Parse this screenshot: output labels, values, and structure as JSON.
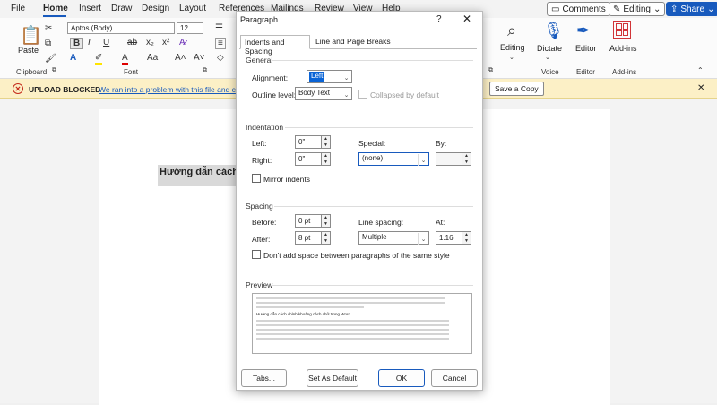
{
  "menu": {
    "items": [
      "File",
      "Home",
      "Insert",
      "Draw",
      "Design",
      "Layout",
      "References",
      "Mailings",
      "Review",
      "View",
      "Help"
    ]
  },
  "topbar": {
    "comments_label": "Comments",
    "editing_label": "Editing",
    "share_label": "Share"
  },
  "ribbon": {
    "paste_label": "Paste",
    "font_name": "Aptos (Body)",
    "font_size": "12",
    "groups": {
      "clipboard": "Clipboard",
      "font": "Font",
      "voice": "Voice",
      "editor": "Editor",
      "addins": "Add-ins"
    },
    "editing_label": "Editing",
    "dictate_label": "Dictate",
    "editor_label": "Editor",
    "addins_label": "Add-ins"
  },
  "upload_bar": {
    "title": "UPLOAD BLOCKED",
    "message": "We ran into a problem with this file and c",
    "save_copy_label": "Save a Copy"
  },
  "document": {
    "heading": "Hướng dẫn cách c"
  },
  "dialog": {
    "title": "Paragraph",
    "help": "?",
    "close": "✕",
    "tabs": [
      "Indents and Spacing",
      "Line and Page Breaks"
    ],
    "general": {
      "section": "General",
      "alignment_label": "Alignment:",
      "alignment_value": "Left",
      "outline_label": "Outline level:",
      "outline_value": "Body Text",
      "collapsed_label": "Collapsed by default"
    },
    "indentation": {
      "section": "Indentation",
      "left_label": "Left:",
      "left_value": "0\"",
      "right_label": "Right:",
      "right_value": "0\"",
      "special_label": "Special:",
      "special_value": "(none)",
      "by_label": "By:",
      "mirror_label": "Mirror indents"
    },
    "spacing": {
      "section": "Spacing",
      "before_label": "Before:",
      "before_value": "0 pt",
      "after_label": "After:",
      "after_value": "8 pt",
      "line_spacing_label": "Line spacing:",
      "line_spacing_value": "Multiple",
      "at_label": "At:",
      "at_value": "1.16",
      "dont_add_label": "Don't add space between paragraphs of the same style"
    },
    "preview": {
      "section": "Preview",
      "sample_text": "Hướng dẫn cách chỉnh khoảng cách chữ trong Word"
    },
    "buttons": {
      "tabs": "Tabs...",
      "set_default": "Set As Default",
      "ok": "OK",
      "cancel": "Cancel"
    }
  }
}
